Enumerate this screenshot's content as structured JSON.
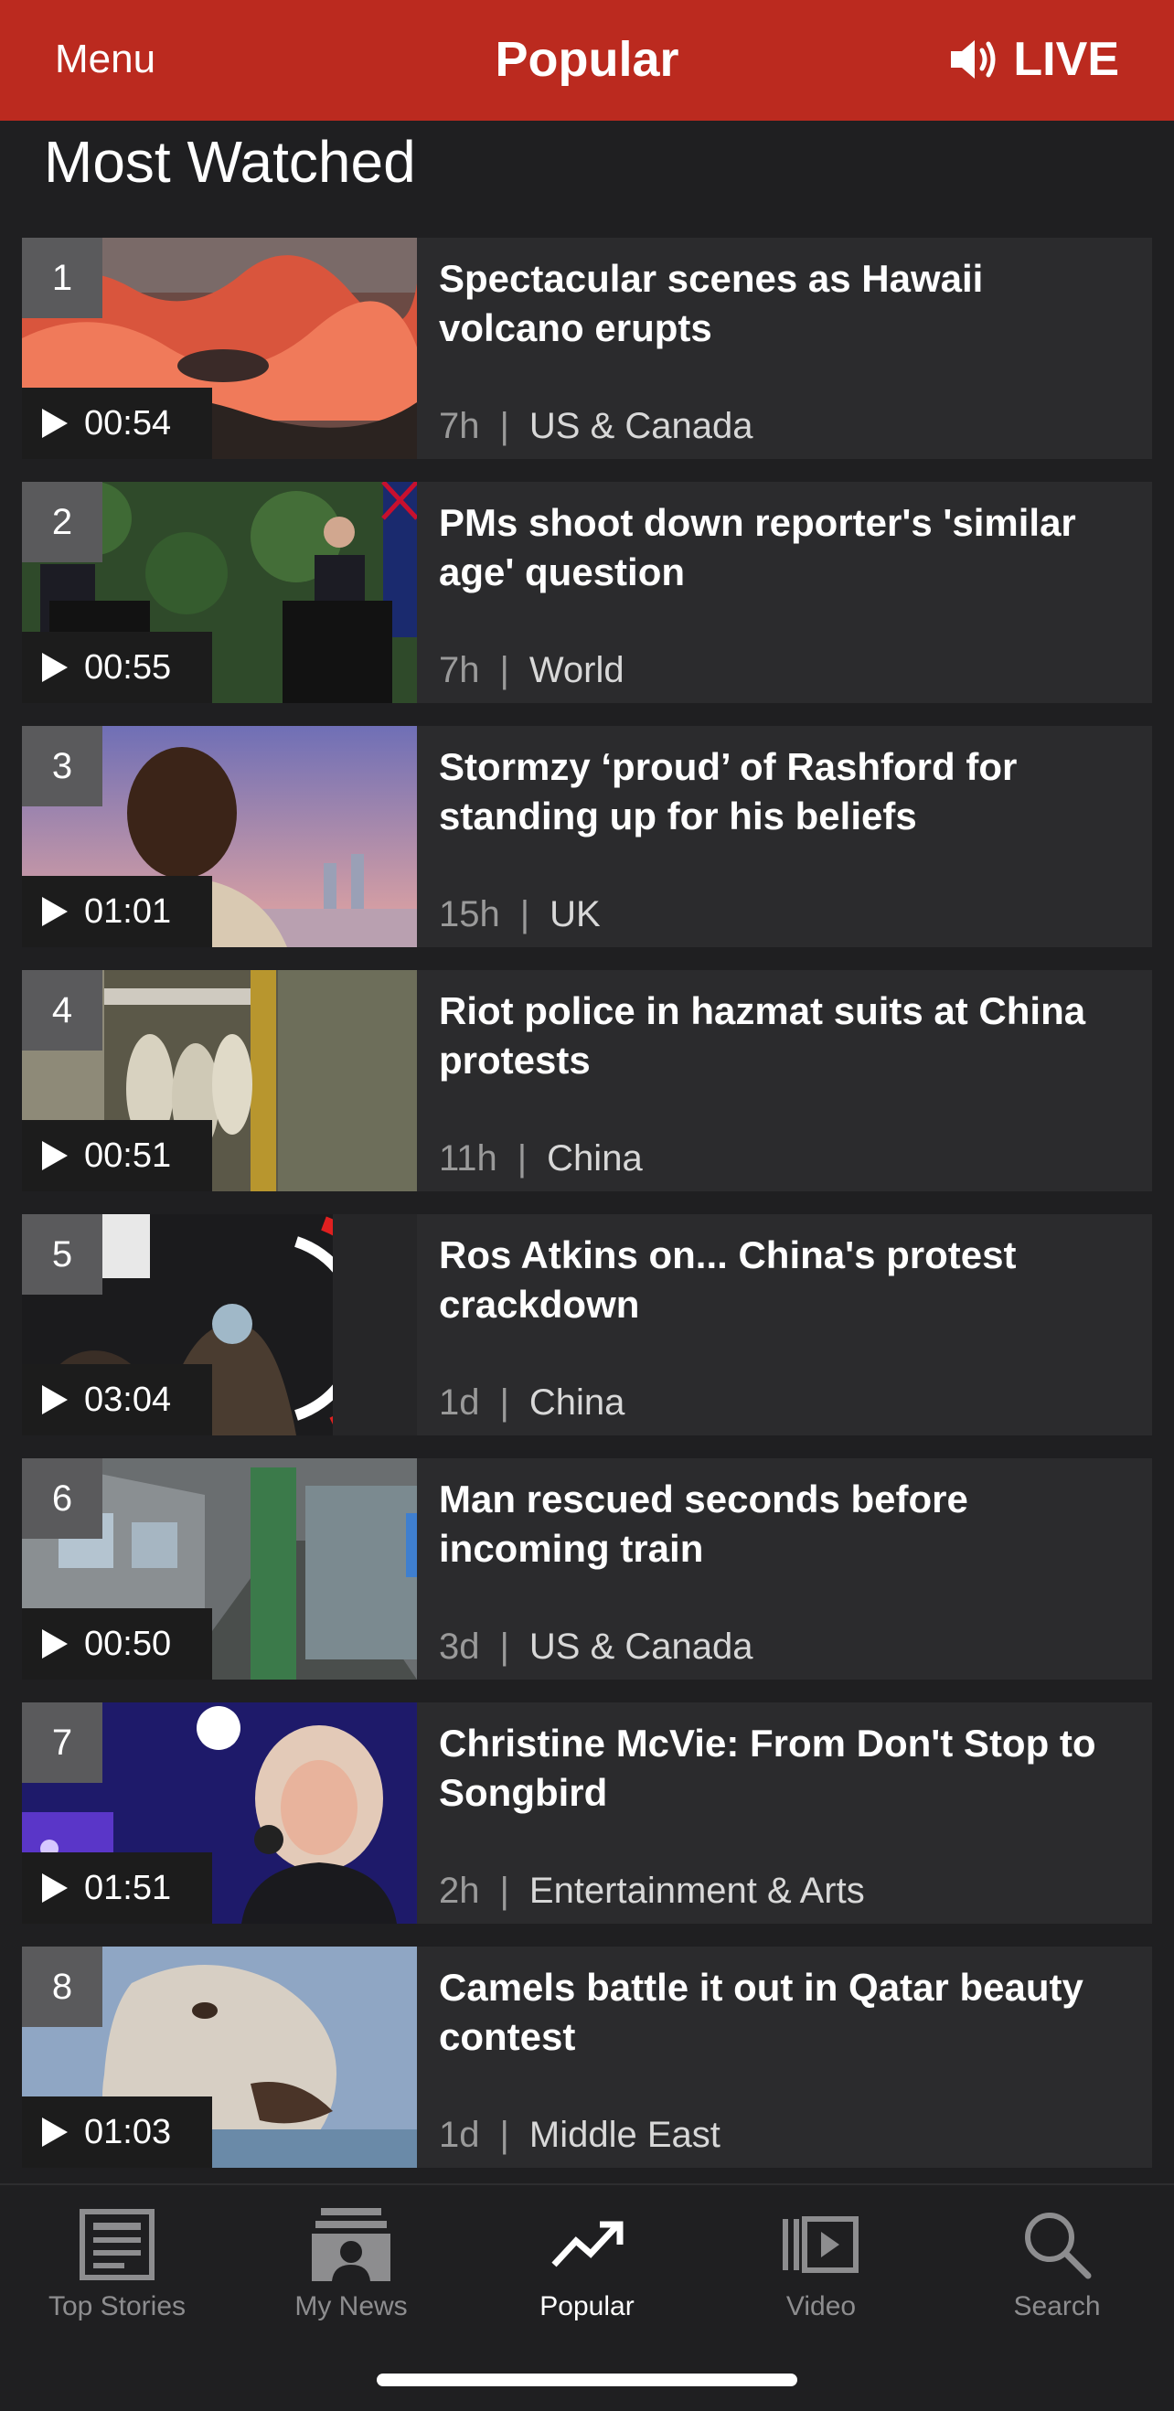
{
  "header": {
    "menu_label": "Menu",
    "title": "Popular",
    "live_label": "LIVE",
    "background": "#bb2a1f"
  },
  "section_title": "Most Watched",
  "items": [
    {
      "rank": "1",
      "duration": "00:54",
      "headline": "Spectacular scenes as Hawaii volcano erupts",
      "age": "7h",
      "category": "US & Canada"
    },
    {
      "rank": "2",
      "duration": "00:55",
      "headline": "PMs shoot down reporter's 'similar age' question",
      "age": "7h",
      "category": "World"
    },
    {
      "rank": "3",
      "duration": "01:01",
      "headline": "Stormzy ‘proud’ of Rashford for standing up for his beliefs",
      "age": "15h",
      "category": "UK"
    },
    {
      "rank": "4",
      "duration": "00:51",
      "headline": "Riot police in hazmat suits at China protests",
      "age": "11h",
      "category": "China"
    },
    {
      "rank": "5",
      "duration": "03:04",
      "headline": "Ros Atkins on... China's protest crackdown",
      "age": "1d",
      "category": "China"
    },
    {
      "rank": "6",
      "duration": "00:50",
      "headline": "Man rescued seconds before incoming train",
      "age": "3d",
      "category": "US & Canada"
    },
    {
      "rank": "7",
      "duration": "01:51",
      "headline": "Christine McVie: From Don't Stop to Songbird",
      "age": "2h",
      "category": "Entertainment & Arts"
    },
    {
      "rank": "8",
      "duration": "01:03",
      "headline": "Camels battle it out in Qatar beauty contest",
      "age": "1d",
      "category": "Middle East"
    }
  ],
  "tabs": [
    {
      "label": "Top Stories",
      "icon": "newspaper-icon",
      "active": false
    },
    {
      "label": "My News",
      "icon": "my-news-icon",
      "active": false
    },
    {
      "label": "Popular",
      "icon": "trending-icon",
      "active": true
    },
    {
      "label": "Video",
      "icon": "video-icon",
      "active": false
    },
    {
      "label": "Search",
      "icon": "search-icon",
      "active": false
    }
  ]
}
